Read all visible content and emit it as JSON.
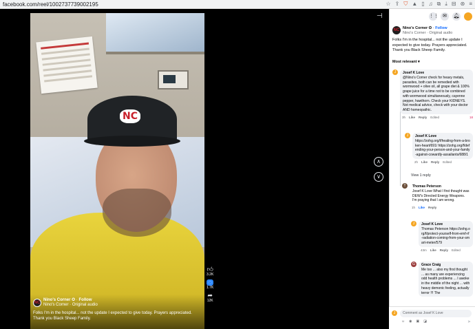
{
  "browser": {
    "url": "facebook.com/reel/1002737739002195"
  },
  "video": {
    "author_name": "Nino's Corner",
    "verified": "✪",
    "follow_label": "Follow",
    "audio_label": "Nino's Corner · Original audio",
    "caption": "Folks I'm in the hospital... not the update I expected to give today. Prayers appreciated. Thank you Black Sheep Family.",
    "logo_text": "NC",
    "actions": [
      {
        "icon": "like-icon",
        "count": "3.2K"
      },
      {
        "icon": "comment-icon",
        "count": "1.7K"
      },
      {
        "icon": "share-icon",
        "count": "12K"
      }
    ]
  },
  "panel": {
    "author_name": "Nino's Corner",
    "follow_label": "Follow",
    "audio_label": "Nino's Corner · Original audio",
    "post_text": "Folks I'm in the hospital... not the update I expected to give today. Prayers appreciated. Thank you Black Sheep Family.",
    "sort_label": "Most relevant"
  },
  "comments": [
    {
      "author": "Josef K Love",
      "text": "@Nino's Corner check for heavy metals, parasites, both can be remedied with wormwood + olive oil, all grape diet & 100% grape juice for a time not to be combined with wormwood simultaneously, cayenne pepper, hawthorn. Check your KIDNEYS. Not medical advice, check with your doctor AND homeopathic.",
      "time": "3h",
      "like": "Like",
      "reply": "Reply",
      "edited": "Edited",
      "reactions": "18"
    },
    {
      "author": "Josef K Love",
      "text": "https://zohg.org/f/healing-from-a-broken-heart/691/ https://zohg.org/f/defending-your-person-and-your-family-against-cowardly-assailants/688/1",
      "time": "2h",
      "like": "Like",
      "reply": "Reply",
      "edited": "Edited"
    },
    {
      "author": "Thomas Peterson",
      "text": "Josef K Love What I first thought was DEW's Directed Energy Weapons. I'm praying that I am wrong.",
      "time": "1h",
      "like": "Like",
      "reply": "Reply"
    },
    {
      "author": "Josef K Love",
      "text": "Thomas Peterson https://zohg.org/f/protect-yourself-from-emf-rf-radiation-coming-from-your-smart-meter/579",
      "time": "43m",
      "like": "Like",
      "reply": "Reply",
      "edited": "Edited"
    },
    {
      "author": "Grace Craig",
      "text": "Me too ... also my first thought ... as many are experiencing odd health problems ... I awoke in the middle of the night ... with heavy demonic feeling, actually terror !!! The"
    }
  ],
  "view_reply": "View 1 reply",
  "compose": {
    "placeholder": "Comment as Josef K Love"
  },
  "colors": {
    "accent": "#0866ff",
    "video_bg": "#000000",
    "bubble": "#f0f2f5"
  }
}
